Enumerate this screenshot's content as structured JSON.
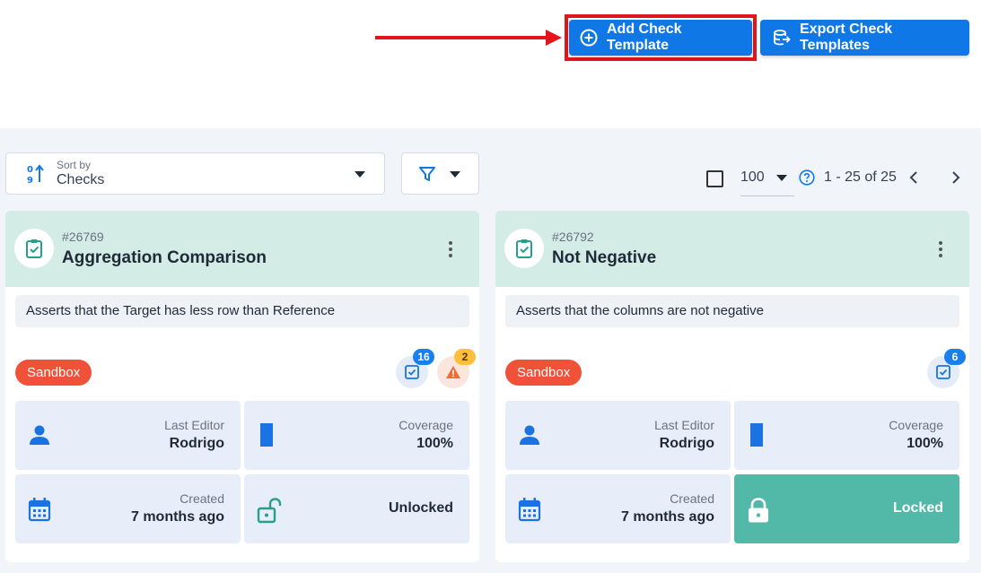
{
  "toolbar": {
    "add_label": "Add Check Template",
    "export_label": "Export Check Templates"
  },
  "controls": {
    "sort_caption": "Sort by",
    "sort_value": "Checks",
    "per_page": "100",
    "range": "1 - 25 of 25"
  },
  "colors": {
    "primary": "#1077e6",
    "highlight": "#e3141b",
    "card_header": "#d4ece6",
    "sandbox_pill": "#ef5238",
    "locked_tile": "#52b9a8"
  },
  "cards": [
    {
      "id": "#26769",
      "title": "Aggregation Comparison",
      "description": "Asserts that the Target has less row than Reference",
      "tag": "Sandbox",
      "checks_count": "16",
      "warnings_count": "2",
      "last_editor_label": "Last Editor",
      "last_editor": "Rodrigo",
      "coverage_label": "Coverage",
      "coverage": "100%",
      "created_label": "Created",
      "created": "7 months ago",
      "lock_status": "Unlocked"
    },
    {
      "id": "#26792",
      "title": "Not Negative",
      "description": "Asserts that the columns are not negative",
      "tag": "Sandbox",
      "checks_count": "6",
      "last_editor_label": "Last Editor",
      "last_editor": "Rodrigo",
      "coverage_label": "Coverage",
      "coverage": "100%",
      "created_label": "Created",
      "created": "7 months ago",
      "lock_status": "Locked"
    }
  ]
}
